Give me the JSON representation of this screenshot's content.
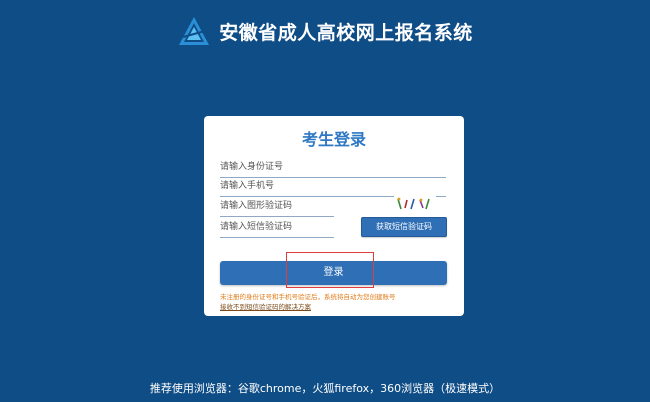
{
  "header": {
    "logo_icon": "triangle-logo-icon",
    "title": "安徽省成人高校网上报名系统"
  },
  "login_card": {
    "title": "考生登录",
    "id_card_placeholder": "请输入身份证号",
    "phone_placeholder": "请输入手机号",
    "captcha_placeholder": "请输入图形验证码",
    "sms_code_placeholder": "请输入短信验证码",
    "sms_button_label": "获取短信验证码",
    "login_button_label": "登录",
    "note": "未注册的身份证号和手机号验证后，系统将自动为您创建账号",
    "help_link": "接收不到短信验证码的解决方案"
  },
  "footer": {
    "browser_recommendation": "推荐使用浏览器：谷歌chrome，火狐firefox，360浏览器（极速模式）"
  },
  "colors": {
    "background": "#0f4d86",
    "accent": "#2f6fb5",
    "title_blue": "#2f78c4",
    "highlight_red": "#e23b3b",
    "note_orange": "#e07b1a"
  }
}
